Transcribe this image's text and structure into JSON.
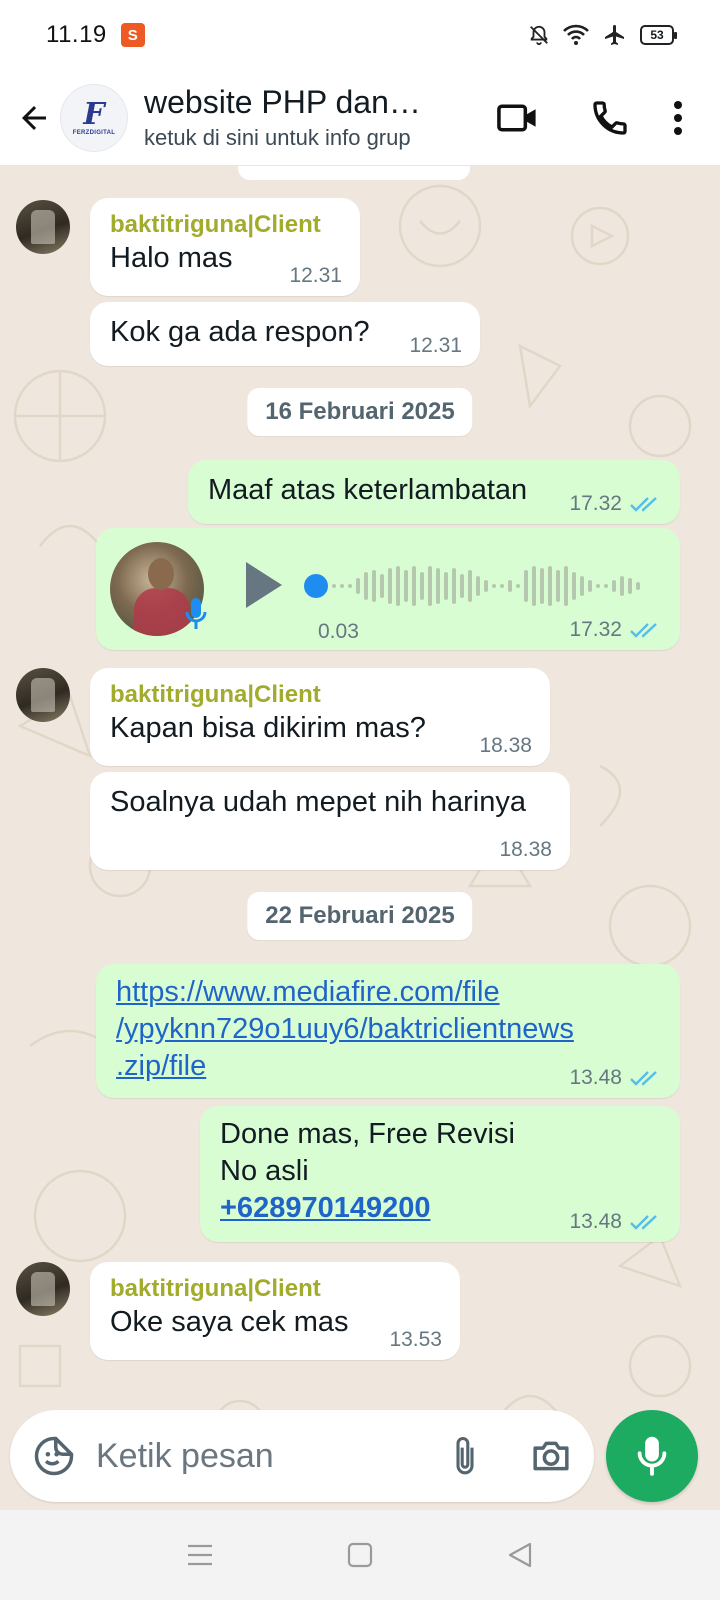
{
  "status_bar": {
    "time": "11.19",
    "battery": "53"
  },
  "header": {
    "title": "website PHP dan…",
    "subtitle": "ketuk di sini untuk info grup",
    "avatar_text": "FERZDIGITAL",
    "avatar_letter": "F"
  },
  "messages": [
    {
      "sender": "baktitriguna|Client",
      "text": "Halo mas",
      "time": "12.31"
    },
    {
      "text": "Kok ga ada respon?",
      "time": "12.31"
    },
    {
      "date": "16 Februari 2025"
    },
    {
      "text": "Maaf atas keterlambatan",
      "time": "17.32"
    },
    {
      "voice_duration": "0.03",
      "voice_progress": 0,
      "time": "17.32"
    },
    {
      "sender": "baktitriguna|Client",
      "text": "Kapan bisa dikirim mas?",
      "time": "18.38"
    },
    {
      "text": "Soalnya udah mepet nih harinya",
      "time": "18.38"
    },
    {
      "date": "22 Februari 2025"
    },
    {
      "link": [
        "https://www.mediafire.com/file",
        "/ypyknn729o1uuy6/baktriclientnews",
        ".zip/file"
      ],
      "time": "13.48"
    },
    {
      "text_lines": [
        "Done mas, Free Revisi",
        "No asli"
      ],
      "phone": "+628970149200",
      "time": "13.48"
    },
    {
      "sender": "baktitriguna|Client",
      "text": "Oke saya cek mas",
      "time": "13.53"
    }
  ],
  "input": {
    "placeholder": "Ketik pesan"
  },
  "colors": {
    "accent_green": "#1daa61",
    "outgoing_bubble": "#d9fdd3",
    "incoming_bubble": "#ffffff",
    "sender_name": "#a3ab2c",
    "read_ticks": "#53bdeb",
    "link": "#1f64c8",
    "chat_background": "#efe7dd"
  },
  "icons": {
    "back": "arrow-left-icon",
    "video": "video-call-icon",
    "call": "phone-icon",
    "menu": "more-vert-icon",
    "emoji": "sticker-emoji-icon",
    "attach": "paperclip-icon",
    "camera": "camera-icon",
    "mic": "mic-icon",
    "ticks": "double-check-icon",
    "play": "play-icon",
    "nav_menu": "recent-apps-icon",
    "nav_home": "home-icon",
    "nav_back": "nav-back-icon"
  }
}
